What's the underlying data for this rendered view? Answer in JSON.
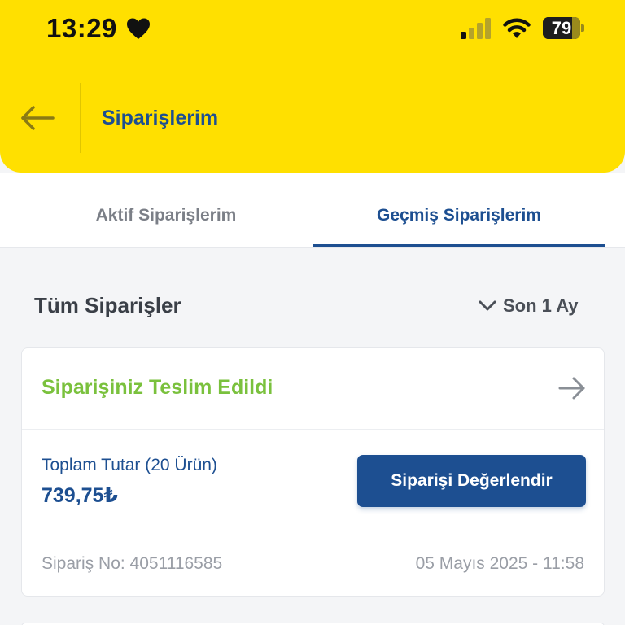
{
  "status_bar": {
    "time": "13:29",
    "battery": "79",
    "battery_percent": 79
  },
  "header": {
    "title": "Siparişlerim",
    "back_icon": "arrow-left-icon",
    "background_color": "#ffe000"
  },
  "tabs": [
    {
      "label": "Aktif Siparişlerim",
      "active": false
    },
    {
      "label": "Geçmiş Siparişlerim",
      "active": true
    }
  ],
  "section": {
    "title": "Tüm Siparişler",
    "filter_label": "Son 1 Ay",
    "filter_icon": "chevron-down-icon"
  },
  "order": {
    "status": "Siparişiniz Teslim Edildi",
    "status_color": "#7ac13d",
    "total_label": "Toplam Tutar (20 Ürün)",
    "total_value": "739,75₺",
    "rate_button": "Siparişi Değerlendir",
    "order_number": "Sipariş No: 4051116585",
    "date": "05 Mayıs 2025 - 11:58"
  },
  "colors": {
    "brand_blue": "#1d4f91",
    "brand_yellow": "#ffe000"
  }
}
